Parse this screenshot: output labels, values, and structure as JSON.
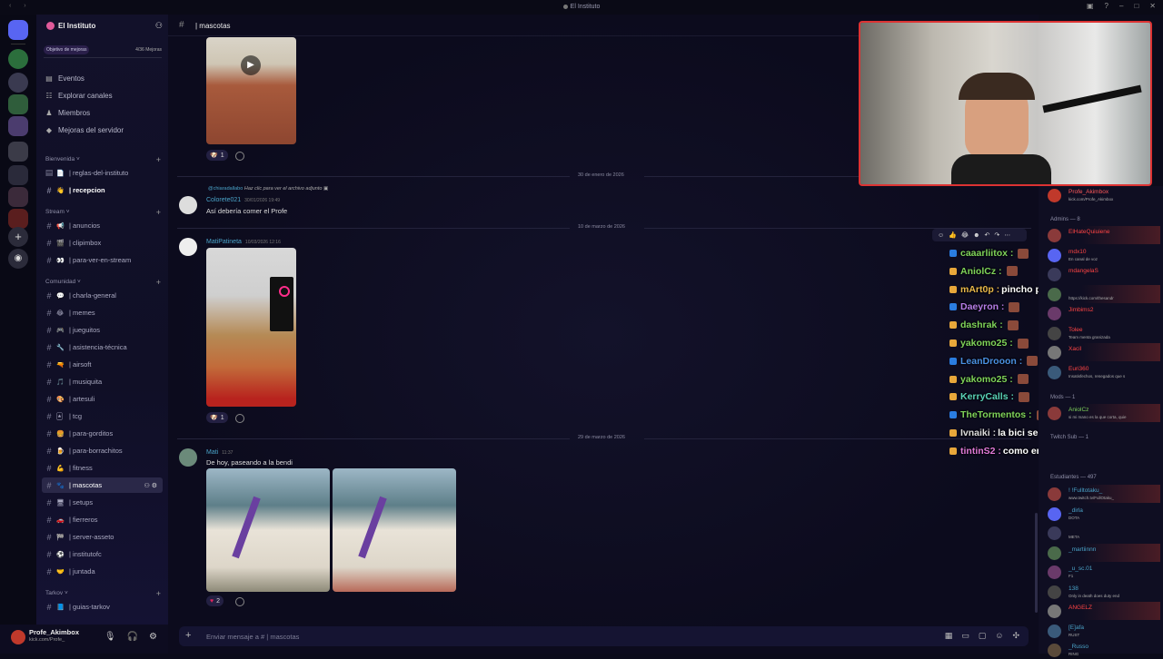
{
  "window": {
    "title": "El Instituto"
  },
  "guild": {
    "name": "El Instituto",
    "boost_label": "Objetivo de mejoras",
    "boost_count": "4/36 Mejoras"
  },
  "nav": [
    {
      "label": "Eventos",
      "icon": "calendar-icon",
      "glyph": "▤"
    },
    {
      "label": "Explorar canales",
      "icon": "explore-icon",
      "glyph": "☷"
    },
    {
      "label": "Miembros",
      "icon": "members-icon",
      "glyph": "♟"
    },
    {
      "label": "Mejoras del servidor",
      "icon": "boost-icon",
      "glyph": "◆"
    }
  ],
  "categories": {
    "bienvenida": "Bienvenida",
    "stream": "Stream",
    "comunidad": "Comunidad",
    "tarkov": "Tarkov"
  },
  "channels": {
    "reglas": "| reglas-del-instituto",
    "recepcion": "| recepcion",
    "anuncios": "| anuncios",
    "clipimbox": "| clipimbox",
    "para_ver": "| para-ver-en-stream",
    "charla": "| charla-general",
    "memes": "| memes",
    "jueguitos": "| jueguitos",
    "asistencia": "| asistencia-técnica",
    "airsoft": "| airsoft",
    "musiquita": "| musiquita",
    "artesuli": "| artesuli",
    "tcg": "| tcg",
    "para_gorditos": "| para-gorditos",
    "para_borrachitos": "| para-borrachitos",
    "fitness": "| fitness",
    "mascotas": "| mascotas",
    "setups": "| setups",
    "fierreros": "| fierreros",
    "server_asseto": "| server-asseto",
    "institutofc": "| institutofc",
    "juntada": "| juntada",
    "guias_tarkov": "| guias-tarkov"
  },
  "user": {
    "name": "Profe_Akimbox",
    "status": "kick.com/Profe_"
  },
  "header": {
    "channel": "| mascotas"
  },
  "messages": {
    "react1_count": "1",
    "divider1": "30 de enero de 2026",
    "reply_user": "@chiaradallabo",
    "reply_text": "Haz clic para ver el archivo adjunto",
    "author2": "Colorete021",
    "ts2": "30/01/2026 19:49",
    "text2": "Así debería comer el Profe",
    "divider2": "10 de marzo de 2026",
    "author3": "MatiPatineta",
    "ts3": "10/03/2026 12:16",
    "react3_count": "1",
    "divider3": "29 de marzo de 2026",
    "author4": "Mati",
    "ts4": "11:37",
    "text4": "De hoy, paseando a la bendi",
    "react4_count": "2"
  },
  "composer": {
    "placeholder": "Enviar mensaje a # | mascotas"
  },
  "chat_overlay": [
    {
      "user": "caaarliitox :",
      "msg": "",
      "color": "#7fd35a"
    },
    {
      "user": "AniolCz :",
      "msg": "",
      "color": "#7fd35a"
    },
    {
      "user": "mArt0p :",
      "msg": "pincho pincha",
      "color": "#e8b84a"
    },
    {
      "user": "Daeyron :",
      "msg": "",
      "color": "#b77ee8"
    },
    {
      "user": "dashrak :",
      "msg": "",
      "color": "#7fd35a"
    },
    {
      "user": "yakomo25 :",
      "msg": "",
      "color": "#7fd35a"
    },
    {
      "user": "LeanDrooon :",
      "msg": "",
      "color": "#4a90e2"
    },
    {
      "user": "yakomo25 :",
      "msg": "",
      "color": "#7fd35a"
    },
    {
      "user": "KerryCalls :",
      "msg": "",
      "color": "#5ad3b8"
    },
    {
      "user": "TheTormentos :",
      "msg": "",
      "color": "#7fd35a"
    },
    {
      "user": "Ivnaiki :",
      "msg": "la bici se aflojo",
      "color": "#dddddd"
    },
    {
      "user": "tintinS2 :",
      "msg": "como entra la blublubi",
      "color": "#e07ad8"
    }
  ],
  "members": {
    "top": {
      "name": "Profe_Akimbox",
      "status": "kick.com/Profe_Akimbox"
    },
    "admins_label": "Admins — 8",
    "admins": [
      {
        "name": "ElHateQuiuiene",
        "status": "",
        "color": "#ff4444"
      },
      {
        "name": "mdx10",
        "status": "En canal de voz",
        "color": "#ff4444"
      },
      {
        "name": "mdangelaS",
        "status": "",
        "color": "#ff4444"
      },
      {
        "name": "",
        "status": "https://kick.com/thesandr",
        "color": "#ff4444"
      },
      {
        "name": "Jimbims2",
        "status": "",
        "color": "#ff4444"
      },
      {
        "name": "Tolee",
        "status": "Team menta granizada",
        "color": "#ff4444"
      },
      {
        "name": "Xacil",
        "status": "",
        "color": "#ff4444"
      },
      {
        "name": "Euri360",
        "status": "Insatisfechos, renegados que s",
        "color": "#ff4444"
      }
    ],
    "mods_label": "Mods — 1",
    "mods": [
      {
        "name": "AniolCz",
        "status": "si mi mano es la que corta, quie",
        "color": "#7fd35a"
      }
    ],
    "sub_label": "Twitch Sub — 1",
    "students_label": "Estudiantes — 497",
    "students": [
      {
        "name": "! !Fulltotaku_",
        "status": "www.twitch.tv/FullOtaku_",
        "color": "#4aa3c8"
      },
      {
        "name": "_dirla",
        "status": "DOTA",
        "color": "#4aa3c8"
      },
      {
        "name": "",
        "status": "META",
        "color": "#4aa3c8"
      },
      {
        "name": "_martiinnn",
        "status": "",
        "color": "#4aa3c8"
      },
      {
        "name": "_u_sc.01",
        "status": "F1",
        "color": "#4aa3c8"
      },
      {
        "name": "138",
        "status": "Only in death does duty end",
        "color": "#4aa3c8"
      },
      {
        "name": "ANGELZ",
        "status": "",
        "color": "#ff4444"
      },
      {
        "name": "[E]afa",
        "status": "RUST",
        "color": "#4aa3c8"
      },
      {
        "name": "_Russo",
        "status": "RING",
        "color": "#4aa3c8"
      }
    ]
  }
}
